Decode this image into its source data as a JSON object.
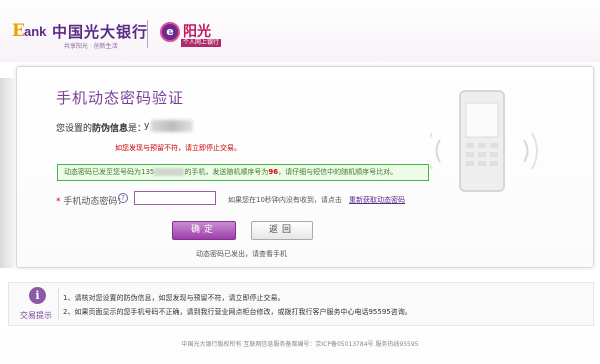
{
  "header": {
    "logo_e": "E",
    "logo_ank": "ank",
    "logo_cn": "中国光大银行",
    "logo_slogan": "共享阳光 · 创新生活",
    "badge_glyph": "e",
    "badge_title": "阳光",
    "badge_sub": "个人网上银行"
  },
  "main": {
    "title": "手机动态密码验证",
    "anti_phish_prefix": "您设置的",
    "anti_phish_bold": "防伪信息",
    "anti_phish_suffix": "是：",
    "anti_phish_value": "y",
    "warning": "如您发现与预留不符，请立即停止交易。",
    "notice": {
      "part1": "动态密码已发至您号码为135",
      "part2": "的手机，发送随机顺序号为",
      "serial": "96",
      "part3": "，请仔细与短信中的随机顺序号比对。"
    },
    "otp_label": "手机动态密码：",
    "otp_star": "*",
    "help_glyph": "?",
    "otp_value": "",
    "resend_text": "如果您在10秒钟内没有收到，请点击",
    "resend_link": "重新获取动态密码",
    "confirm_label": "确定",
    "back_label": "返回",
    "sent_text": "动态密码已发出，请查看手机"
  },
  "tips": {
    "icon_glyph": "i",
    "title": "交易提示",
    "items": [
      "1、请核对您设置的防伪信息，如您发现与预留不符，请立即停止交易。",
      "2、如果页面显示的您手机号码不正确，请到我行营业网点柜台修改，或拨打我行客户服务中心电话95595咨询。"
    ]
  },
  "footer": {
    "text": "中国光大银行版权所有  互联网信息服务备案编号：京ICP备05013784号  服务热线95595"
  },
  "colors": {
    "brand_purple": "#7b3f97",
    "warning_red": "#cc0000",
    "notice_green": "#3fb63f"
  }
}
